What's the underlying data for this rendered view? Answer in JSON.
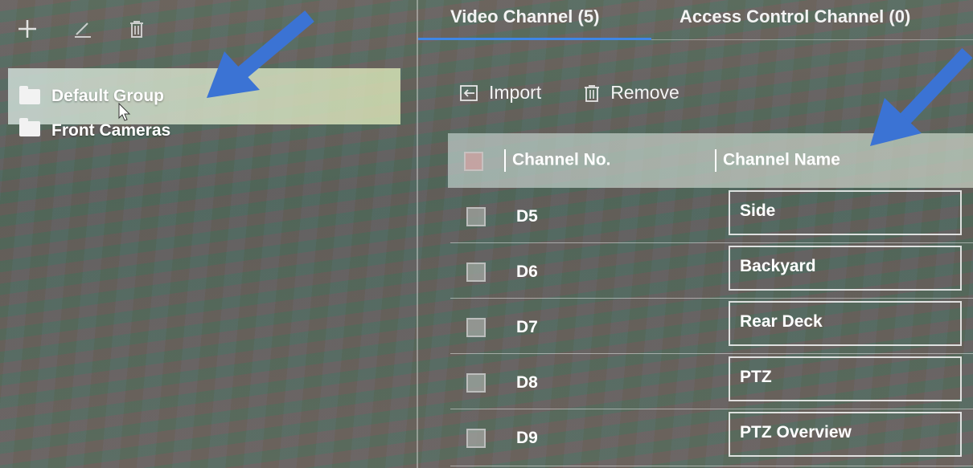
{
  "left_panel": {
    "groups": [
      {
        "label": "Default Group"
      },
      {
        "label": "Front Cameras"
      }
    ]
  },
  "tabs": [
    {
      "label": "Video Channel (5)"
    },
    {
      "label": "Access Control Channel (0)"
    }
  ],
  "actions": {
    "import_label": "Import",
    "remove_label": "Remove"
  },
  "table": {
    "headers": {
      "channel_no": "Channel No.",
      "channel_name": "Channel Name"
    },
    "rows": [
      {
        "no": "D5",
        "name": "Side"
      },
      {
        "no": "D6",
        "name": "Backyard"
      },
      {
        "no": "D7",
        "name": "Rear Deck"
      },
      {
        "no": "D8",
        "name": "PTZ"
      },
      {
        "no": "D9",
        "name": "PTZ Overview"
      }
    ]
  },
  "colors": {
    "accent": "#3f86e6",
    "annotation_arrow": "#3b73d4"
  },
  "icons": [
    "plus-icon",
    "edit-icon",
    "trash-icon",
    "folder-icon",
    "import-icon",
    "cursor-icon",
    "arrow-annotation-icon"
  ]
}
